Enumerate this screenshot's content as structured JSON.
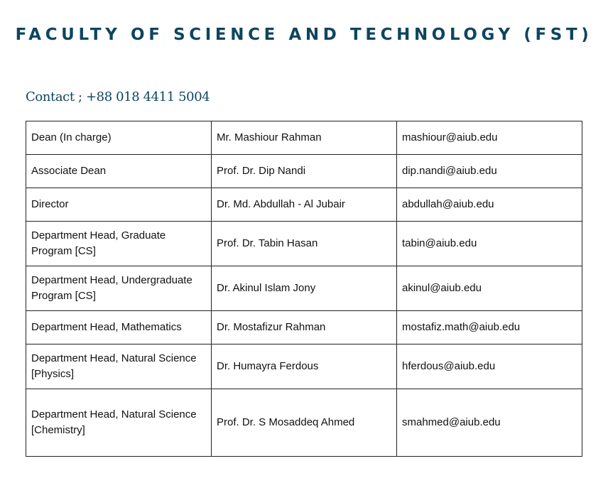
{
  "title": "FACULTY OF SCIENCE AND TECHNOLOGY (FST)",
  "contact": "Contact ; +88 018 4411 5004",
  "rows": [
    {
      "role": "Dean (In charge)",
      "name": "Mr. Mashiour Rahman",
      "email": "mashiour@aiub.edu"
    },
    {
      "role": "Associate Dean",
      "name": "Prof. Dr. Dip Nandi",
      "email": "dip.nandi@aiub.edu"
    },
    {
      "role": "Director",
      "name": "Dr. Md. Abdullah - Al Jubair",
      "email": "abdullah@aiub.edu"
    },
    {
      "role": "Department Head, Graduate Program [CS]",
      "name": "Prof. Dr. Tabin Hasan",
      "email": "tabin@aiub.edu"
    },
    {
      "role": "Department Head, Undergraduate Program [CS]",
      "name": "Dr. Akinul Islam Jony",
      "email": "akinul@aiub.edu"
    },
    {
      "role": "Department Head, Mathematics",
      "name": "Dr. Mostafizur Rahman",
      "email": "mostafiz.math@aiub.edu"
    },
    {
      "role": "Department Head, Natural Science [Physics]",
      "name": "Dr. Humayra Ferdous",
      "email": "hferdous@aiub.edu"
    },
    {
      "role": "Department Head, Natural Science [Chemistry]",
      "name": "Prof. Dr. S Mosaddeq Ahmed",
      "email": "smahmed@aiub.edu"
    }
  ]
}
